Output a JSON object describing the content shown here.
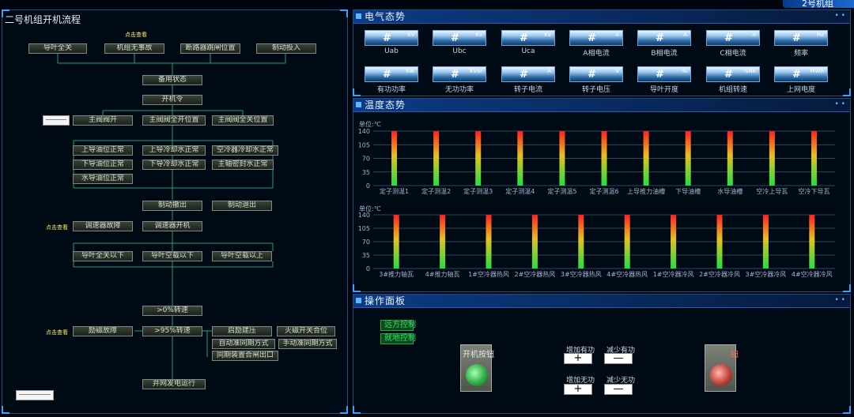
{
  "top_right_title": "2号机组",
  "flow": {
    "title": "二号机组开机流程",
    "click_hint_top": "点击查看",
    "click_hint_mid": "点击查看",
    "click_hint_bottom": "点击查看",
    "row1": [
      "导叶全关",
      "机组无事故",
      "断路器跳闸位置",
      "制动投入"
    ],
    "ready": "备用状态",
    "start_cmd": "开机令",
    "row2": [
      "主阀阀开",
      "主阀阀全开位置",
      "主阀阀全关位置"
    ],
    "row3": [
      "上导油位正常",
      "上导冷却水正常",
      "空冷器冷却水正常"
    ],
    "row4": [
      "下导油位正常",
      "下导冷却水正常",
      "主轴密封水正常"
    ],
    "row5": [
      "水导油位正常"
    ],
    "brake": [
      "制动撤出",
      "制动退出"
    ],
    "governor": [
      "调速器故障",
      "调速器开机"
    ],
    "guide": [
      "导叶全关以下",
      "导叶空载以下",
      "导叶空载以上"
    ],
    "speed_low": ">0%转速",
    "excite_fault": "励磁故障",
    "speed_high": ">95%转速",
    "excite_right": [
      "启励建压",
      "灭磁开关合位",
      "自动准同期方式",
      "手动准同期方式",
      "同期装置合闸出口"
    ],
    "grid": "并网发电运行"
  },
  "electrical": {
    "title": "电气态势",
    "meters": [
      {
        "value": "#",
        "unit": "Kv",
        "label": "Uab"
      },
      {
        "value": "#",
        "unit": "Kv",
        "label": "Ubc"
      },
      {
        "value": "#",
        "unit": "Kv",
        "label": "Uca"
      },
      {
        "value": "#",
        "unit": "A",
        "label": "A相电流"
      },
      {
        "value": "#",
        "unit": "A",
        "label": "B相电流"
      },
      {
        "value": "#",
        "unit": "A",
        "label": "C相电流"
      },
      {
        "value": "#",
        "unit": "Hz",
        "label": "频率"
      },
      {
        "value": "#",
        "unit": "Kw",
        "label": "有功功率"
      },
      {
        "value": "#",
        "unit": "Kvar",
        "label": "无功功率"
      },
      {
        "value": "#",
        "unit": "A",
        "label": "转子电流"
      },
      {
        "value": "#",
        "unit": "V",
        "label": "转子电压"
      },
      {
        "value": "#",
        "unit": "%",
        "label": "导叶开度"
      },
      {
        "value": "#",
        "unit": "%Ne",
        "label": "机组转速"
      },
      {
        "value": "#",
        "unit": "MWh",
        "label": "上网电度"
      }
    ]
  },
  "temperature": {
    "title": "温度态势",
    "unit1": "单位:℃",
    "unit2": "单位:℃"
  },
  "chart_data": [
    {
      "type": "bar",
      "categories": [
        "定子测温1",
        "定子测温2",
        "定子测温3",
        "定子测温4",
        "定子测温5",
        "定子测温6",
        "上导推力油槽",
        "下导油槽",
        "水导油槽",
        "空冷上导瓦",
        "空冷下导瓦"
      ],
      "values": [
        140,
        140,
        140,
        140,
        140,
        140,
        140,
        140,
        140,
        140,
        140
      ],
      "yticks": [
        "0",
        "35",
        "70",
        "105",
        "140"
      ],
      "ylim": [
        0,
        140
      ],
      "xlabel": "",
      "ylabel": "单位:℃"
    },
    {
      "type": "bar",
      "categories": [
        "3#推力轴瓦",
        "4#推力轴瓦",
        "1#空冷器热风",
        "2#空冷器热风",
        "3#空冷器热风",
        "4#空冷器热风",
        "1#空冷器冷风",
        "2#空冷器冷风",
        "3#空冷器冷风",
        "4#空冷器冷风"
      ],
      "values": [
        140,
        140,
        140,
        140,
        140,
        140,
        140,
        140,
        140,
        140
      ],
      "yticks": [
        "0",
        "35",
        "70",
        "105",
        "140"
      ],
      "ylim": [
        0,
        140
      ],
      "xlabel": "",
      "ylabel": "单位:℃"
    }
  ],
  "operation": {
    "title": "操作面板",
    "remote": "远方控制",
    "local": "就地控制",
    "start_button": "开机按钮",
    "stop_button": "停机按钮",
    "inc_active": "增加有功",
    "dec_active": "减少有功",
    "inc_reactive": "增加无功",
    "dec_reactive": "减少无功",
    "plus": "+",
    "minus": "—"
  }
}
